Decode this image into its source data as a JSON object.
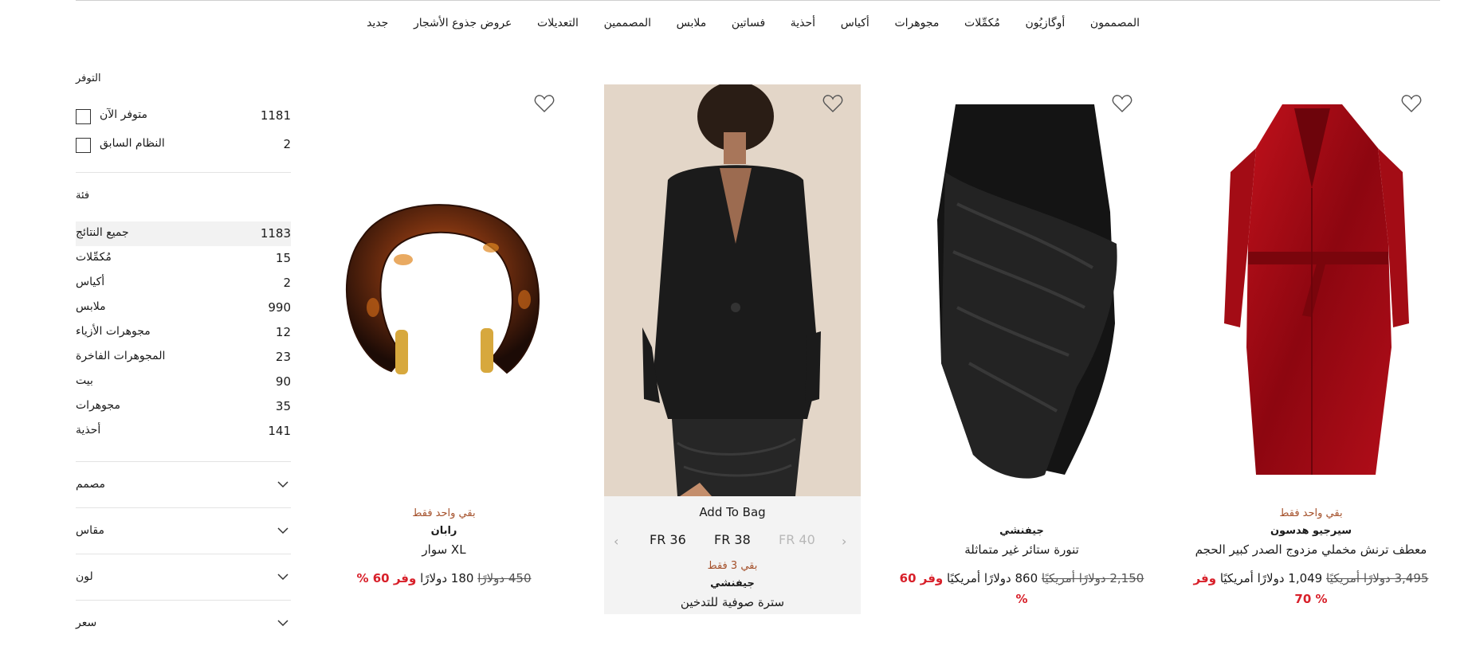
{
  "nav": {
    "items": [
      "المصممون",
      "أوگازيُون",
      "مُكمِّلات",
      "مجوهرات",
      "أكياس",
      "أحذية",
      "فساتين",
      "ملابس",
      "المصممين",
      "التعديلات",
      "عروض جذوع الأشجار",
      "جديد"
    ]
  },
  "sidebar": {
    "availability": {
      "title": "التوفر",
      "options": [
        {
          "label": "متوفر الآن",
          "count": "1181"
        },
        {
          "label": "النظام السابق",
          "count": "2"
        }
      ]
    },
    "category": {
      "title": "فئة",
      "items": [
        {
          "label": "جميع النتائج",
          "count": "1183"
        },
        {
          "label": "مُكمِّلات",
          "count": "15"
        },
        {
          "label": "أكياس",
          "count": "2"
        },
        {
          "label": "ملابس",
          "count": "990"
        },
        {
          "label": "مجوهرات الأزياء",
          "count": "12"
        },
        {
          "label": "المجوهرات الفاخرة",
          "count": "23"
        },
        {
          "label": "بيت",
          "count": "90"
        },
        {
          "label": "مجوهرات",
          "count": "35"
        },
        {
          "label": "أحذية",
          "count": "141"
        }
      ]
    },
    "filters": [
      "مصمم",
      "مقاس",
      "لون",
      "سعر"
    ]
  },
  "products": [
    {
      "image": "tortoiseshell-bracelet-image",
      "stock": "بقي واحد فقط",
      "brand": "رابان",
      "name": "سوار XL",
      "price_old": "450 دولارًا",
      "price_new": "180 دولارًا",
      "save": "وفر 60 %"
    },
    {
      "image": "model-black-blazer-image",
      "add_to_bag": "Add To Bag",
      "sizes": [
        "FR 36",
        "FR 38",
        "FR 40"
      ],
      "stock": "بقي 3 فقط",
      "brand": "جيفنشي",
      "name": "سترة صوفية للتدخين"
    },
    {
      "image": "black-draped-skirt-image",
      "brand": "جيفنشي",
      "name": "تنورة ستائر غير متماثلة",
      "price_old": "2,150 دولارًا أمريكيًا",
      "price_new": "860 دولارًا أمريكيًا",
      "save": "وفر 60",
      "pct": "%"
    },
    {
      "image": "red-velvet-trench-coat-image",
      "stock": "بقي واحد فقط",
      "brand": "سيرجيو هدسون",
      "name": "معطف ترنش مخملي مزدوج الصدر كبير الحجم",
      "price_old": "3,495 دولارًا أمريكيًا",
      "price_new": "1,049 دولارًا أمريكيًا",
      "save": "وفر",
      "pct": "70 %"
    }
  ],
  "colors": {
    "accent_sale": "#d8202a",
    "stock_text": "#a4502a"
  }
}
